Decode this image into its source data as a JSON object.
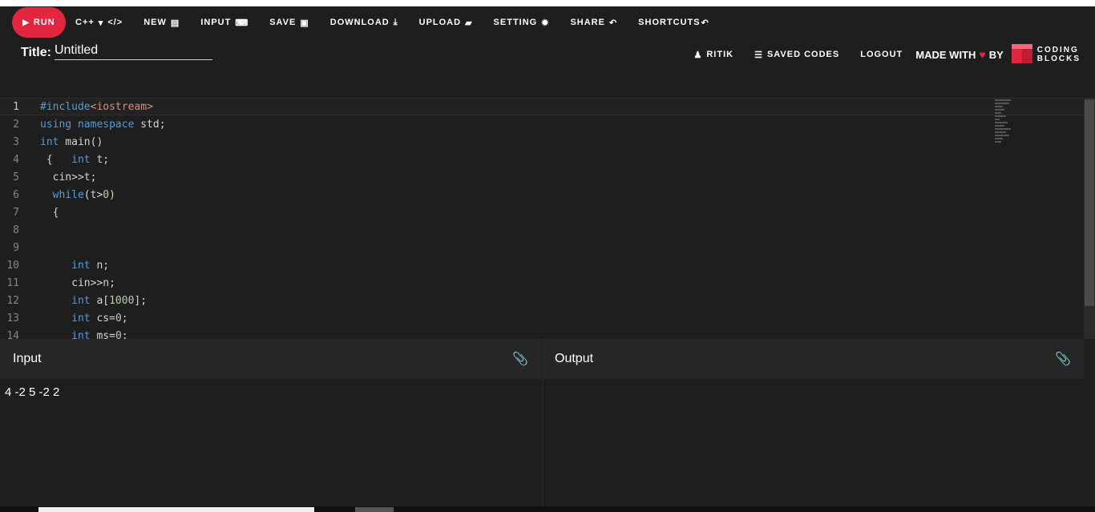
{
  "toolbar": {
    "run": "RUN",
    "language": "C++",
    "new": "NEW",
    "input": "INPUT",
    "save": "SAVE",
    "download": "DOWNLOAD",
    "upload": "UPLOAD",
    "setting": "SETTING",
    "share": "SHARE",
    "shortcuts": "SHORTCUTS"
  },
  "title": {
    "label": "Title:",
    "value": "Untitled"
  },
  "nav": {
    "user": "RITIK",
    "saved_codes": "SAVED CODES",
    "logout": "LOGOUT",
    "made_with": "MADE WITH",
    "by": "BY",
    "logo_line1": "CODING",
    "logo_line2": "BLOCKS"
  },
  "editor": {
    "lines": [
      {
        "n": "1"
      },
      {
        "n": "2"
      },
      {
        "n": "3"
      },
      {
        "n": "4"
      },
      {
        "n": "5"
      },
      {
        "n": "6"
      },
      {
        "n": "7"
      },
      {
        "n": "8"
      },
      {
        "n": "9"
      },
      {
        "n": "10"
      },
      {
        "n": "11"
      },
      {
        "n": "12"
      },
      {
        "n": "13"
      },
      {
        "n": "14"
      }
    ],
    "code": {
      "l1_inc": "#include",
      "l1_hdr": "<iostream>",
      "l2_kw": "using namespace",
      "l2_rest": " std;",
      "l3_kw": "int",
      "l3_rest": " main()",
      "l4_pre": " {   ",
      "l4_kw": "int",
      "l4_rest": " t;",
      "l5": "  cin>>t;",
      "l6_kw": "while",
      "l6_a": "(t>",
      "l6_num": "0",
      "l6_b": ")",
      "l7": "  {",
      "l10_kw": "int",
      "l10_rest": " n;",
      "l11": "cin>>n;",
      "l12_kw": "int",
      "l12_a": " a[",
      "l12_num": "1000",
      "l12_b": "];",
      "l13_kw": "int",
      "l13_a": " cs=",
      "l13_num": "0",
      "l13_b": ";",
      "l14_kw": "int",
      "l14_a": " ms=",
      "l14_num": "0",
      "l14_b": ";"
    }
  },
  "io": {
    "input_title": "Input",
    "output_title": "Output",
    "input_value": "4 -2 5 -2 2",
    "output_value": ""
  },
  "colors": {
    "accent": "#e2263f",
    "background": "#1e1e1e",
    "keyword": "#569cd6",
    "string": "#ce9178",
    "number": "#b5cea8"
  }
}
